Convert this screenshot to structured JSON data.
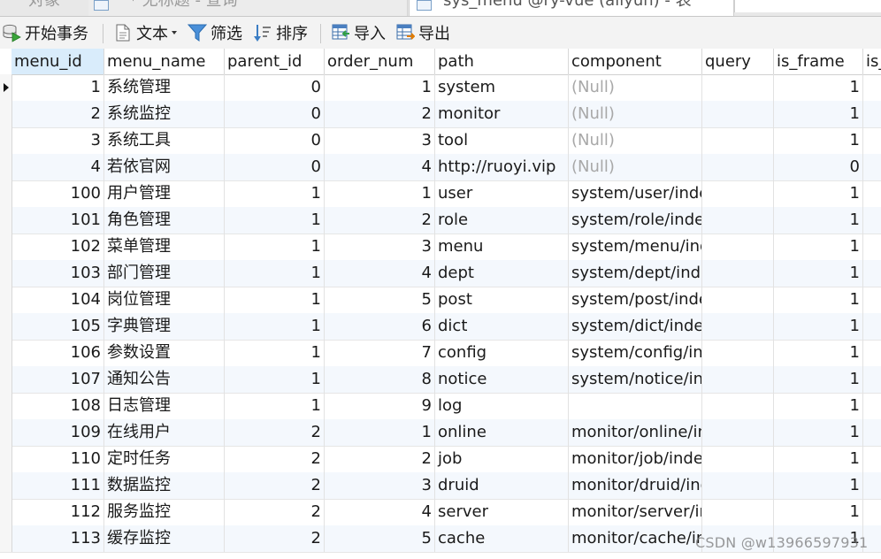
{
  "tabs": {
    "objects_label": "对象",
    "query_label": "* 无标题 - 查询",
    "table_label": "sys_menu @ry-vue (aliyun) - 表"
  },
  "toolbar": {
    "begin_transaction": "开始事务",
    "text": "文本",
    "filter": "筛选",
    "sort": "排序",
    "import": "导入",
    "export": "导出"
  },
  "grid": {
    "columns": [
      "menu_id",
      "menu_name",
      "parent_id",
      "order_num",
      "path",
      "component",
      "query",
      "is_frame",
      "is_"
    ],
    "rows": [
      {
        "menu_id": "1",
        "menu_name": "系统管理",
        "parent_id": "0",
        "order_num": "1",
        "path": "system",
        "component": "(Null)",
        "query": "",
        "is_frame": "1"
      },
      {
        "menu_id": "2",
        "menu_name": "系统监控",
        "parent_id": "0",
        "order_num": "2",
        "path": "monitor",
        "component": "(Null)",
        "query": "",
        "is_frame": "1"
      },
      {
        "menu_id": "3",
        "menu_name": "系统工具",
        "parent_id": "0",
        "order_num": "3",
        "path": "tool",
        "component": "(Null)",
        "query": "",
        "is_frame": "1"
      },
      {
        "menu_id": "4",
        "menu_name": "若依官网",
        "parent_id": "0",
        "order_num": "4",
        "path": "http://ruoyi.vip",
        "component": "(Null)",
        "query": "",
        "is_frame": "0"
      },
      {
        "menu_id": "100",
        "menu_name": "用户管理",
        "parent_id": "1",
        "order_num": "1",
        "path": "user",
        "component": "system/user/index",
        "query": "",
        "is_frame": "1"
      },
      {
        "menu_id": "101",
        "menu_name": "角色管理",
        "parent_id": "1",
        "order_num": "2",
        "path": "role",
        "component": "system/role/index",
        "query": "",
        "is_frame": "1"
      },
      {
        "menu_id": "102",
        "menu_name": "菜单管理",
        "parent_id": "1",
        "order_num": "3",
        "path": "menu",
        "component": "system/menu/index",
        "query": "",
        "is_frame": "1"
      },
      {
        "menu_id": "103",
        "menu_name": "部门管理",
        "parent_id": "1",
        "order_num": "4",
        "path": "dept",
        "component": "system/dept/index",
        "query": "",
        "is_frame": "1"
      },
      {
        "menu_id": "104",
        "menu_name": "岗位管理",
        "parent_id": "1",
        "order_num": "5",
        "path": "post",
        "component": "system/post/index",
        "query": "",
        "is_frame": "1"
      },
      {
        "menu_id": "105",
        "menu_name": "字典管理",
        "parent_id": "1",
        "order_num": "6",
        "path": "dict",
        "component": "system/dict/index",
        "query": "",
        "is_frame": "1"
      },
      {
        "menu_id": "106",
        "menu_name": "参数设置",
        "parent_id": "1",
        "order_num": "7",
        "path": "config",
        "component": "system/config/index",
        "query": "",
        "is_frame": "1"
      },
      {
        "menu_id": "107",
        "menu_name": "通知公告",
        "parent_id": "1",
        "order_num": "8",
        "path": "notice",
        "component": "system/notice/index",
        "query": "",
        "is_frame": "1"
      },
      {
        "menu_id": "108",
        "menu_name": "日志管理",
        "parent_id": "1",
        "order_num": "9",
        "path": "log",
        "component": "",
        "query": "",
        "is_frame": "1"
      },
      {
        "menu_id": "109",
        "menu_name": "在线用户",
        "parent_id": "2",
        "order_num": "1",
        "path": "online",
        "component": "monitor/online/index",
        "query": "",
        "is_frame": "1"
      },
      {
        "menu_id": "110",
        "menu_name": "定时任务",
        "parent_id": "2",
        "order_num": "2",
        "path": "job",
        "component": "monitor/job/index",
        "query": "",
        "is_frame": "1"
      },
      {
        "menu_id": "111",
        "menu_name": "数据监控",
        "parent_id": "2",
        "order_num": "3",
        "path": "druid",
        "component": "monitor/druid/index",
        "query": "",
        "is_frame": "1"
      },
      {
        "menu_id": "112",
        "menu_name": "服务监控",
        "parent_id": "2",
        "order_num": "4",
        "path": "server",
        "component": "monitor/server/index",
        "query": "",
        "is_frame": "1"
      },
      {
        "menu_id": "113",
        "menu_name": "缓存监控",
        "parent_id": "2",
        "order_num": "5",
        "path": "cache",
        "component": "monitor/cache/index",
        "query": "",
        "is_frame": "1"
      }
    ]
  },
  "watermark": "CSDN @w13966597931"
}
